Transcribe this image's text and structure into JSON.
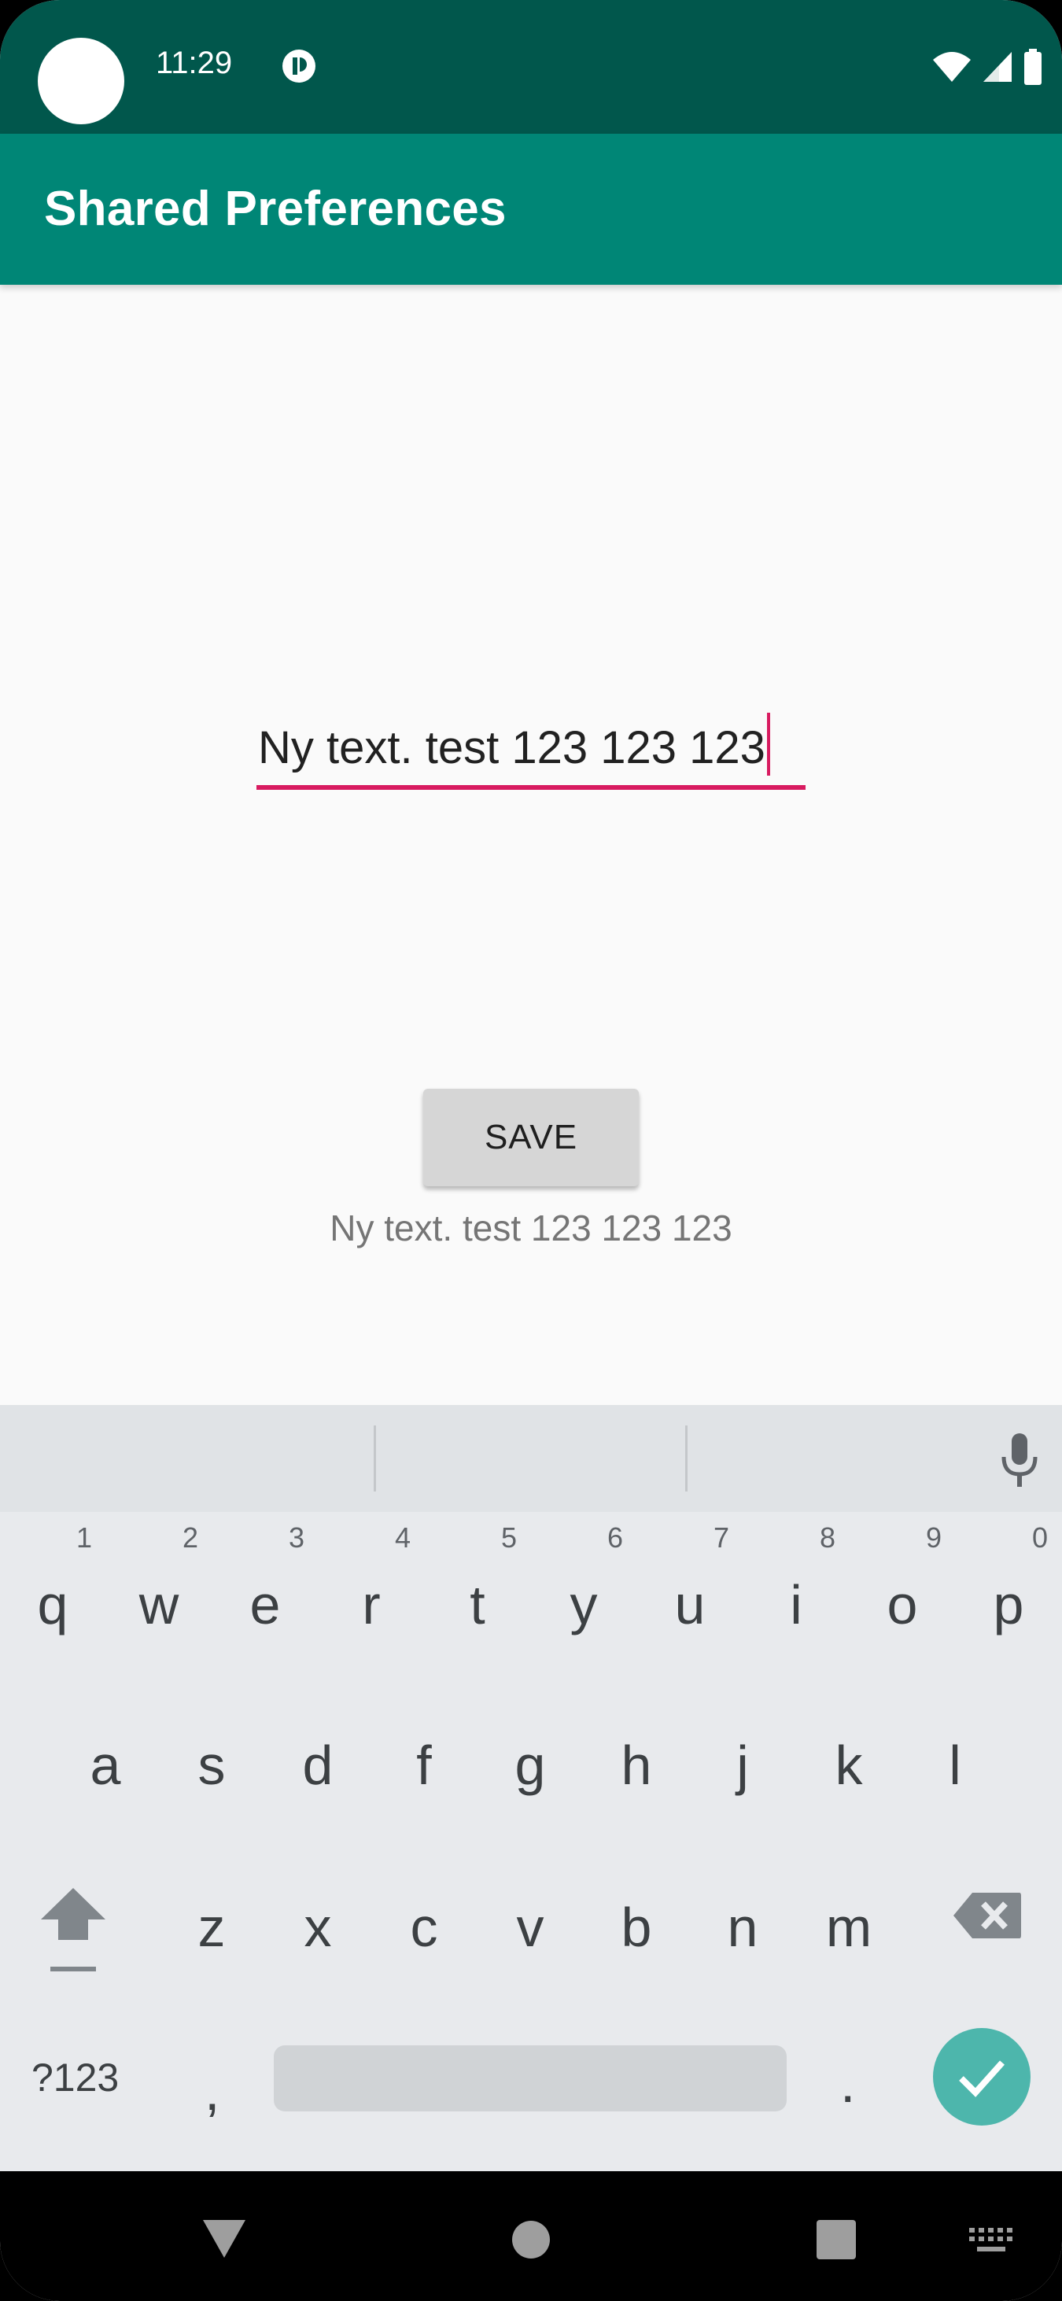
{
  "status_bar": {
    "time": "11:29"
  },
  "app_bar": {
    "title": "Shared Preferences"
  },
  "editor": {
    "value": "Ny text. test 123 123 123"
  },
  "save_button": {
    "label": "SAVE"
  },
  "saved_output": {
    "text": "Ny text. test 123 123 123"
  },
  "keyboard": {
    "row1": [
      {
        "k": "q",
        "h": "1"
      },
      {
        "k": "w",
        "h": "2"
      },
      {
        "k": "e",
        "h": "3"
      },
      {
        "k": "r",
        "h": "4"
      },
      {
        "k": "t",
        "h": "5"
      },
      {
        "k": "y",
        "h": "6"
      },
      {
        "k": "u",
        "h": "7"
      },
      {
        "k": "i",
        "h": "8"
      },
      {
        "k": "o",
        "h": "9"
      },
      {
        "k": "p",
        "h": "0"
      }
    ],
    "row2": [
      "a",
      "s",
      "d",
      "f",
      "g",
      "h",
      "j",
      "k",
      "l"
    ],
    "row3": [
      "z",
      "x",
      "c",
      "v",
      "b",
      "n",
      "m"
    ],
    "symbols_label": "?123",
    "comma": ",",
    "period": "."
  },
  "colors": {
    "status_bar": "#01574c",
    "app_bar": "#008676",
    "accent": "#d81b60",
    "done_key": "#4db6ac"
  },
  "icons": [
    "notification-icon",
    "wifi-icon",
    "signal-icon",
    "battery-icon",
    "mic-icon",
    "shift-icon",
    "backspace-icon",
    "check-icon",
    "back-icon",
    "home-icon",
    "recents-icon",
    "keyboard-switch-icon"
  ]
}
